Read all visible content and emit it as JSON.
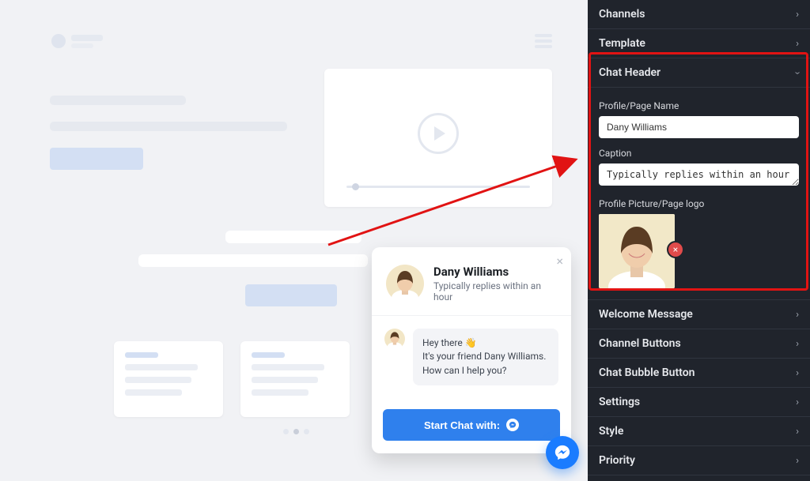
{
  "settings_sections": {
    "channels": "Channels",
    "template": "Template",
    "chat_header": "Chat Header",
    "welcome_message": "Welcome Message",
    "channel_buttons": "Channel Buttons",
    "chat_bubble_button": "Chat Bubble Button",
    "settings": "Settings",
    "style": "Style",
    "priority": "Priority"
  },
  "chat_header_panel": {
    "profile_name_label": "Profile/Page Name",
    "profile_name_value": "Dany Williams",
    "caption_label": "Caption",
    "caption_value": "Typically replies within an hour",
    "profile_picture_label": "Profile Picture/Page logo"
  },
  "chat_widget": {
    "name": "Dany Williams",
    "caption": "Typically replies within an hour",
    "welcome_line1": "Hey there 👋",
    "welcome_line2": "It's your friend Dany Williams. How can I help you?",
    "cta_label": "Start Chat with:"
  }
}
